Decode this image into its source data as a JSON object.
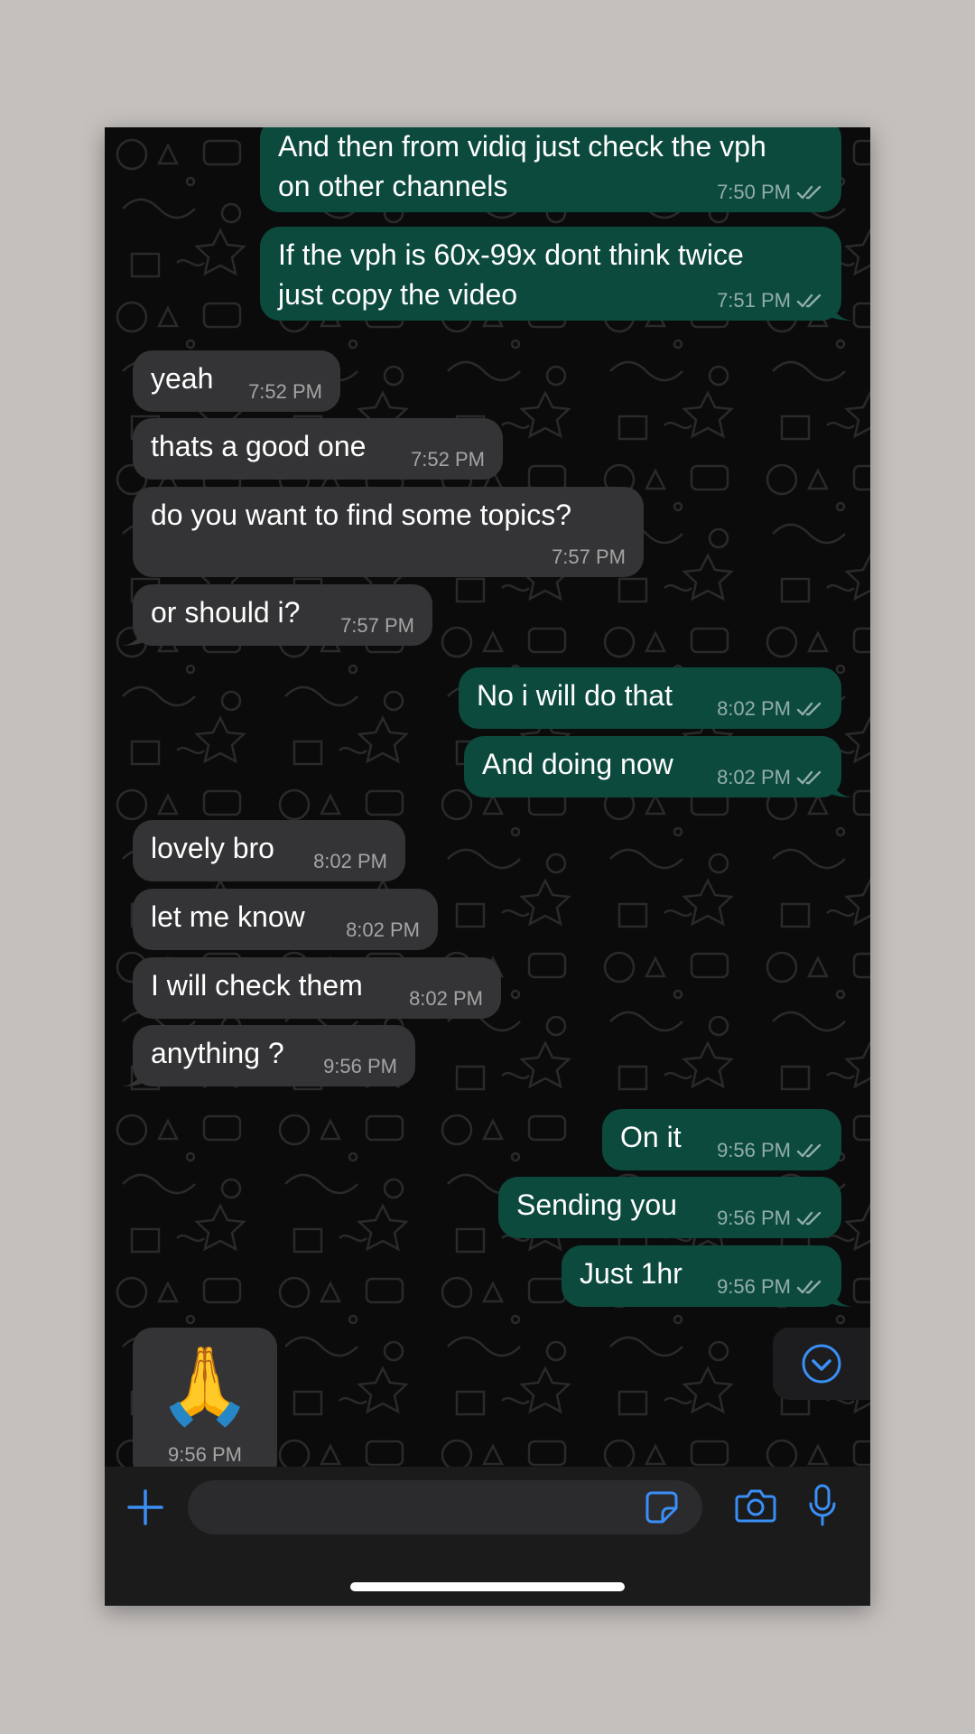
{
  "chat": {
    "messages": [
      {
        "dir": "out",
        "text": "And then from vidiq just check the vph\non other channels",
        "time": "7:50 PM"
      },
      {
        "dir": "out",
        "text": "If the vph is 60x-99x dont think twice\njust copy the video",
        "time": "7:51 PM"
      },
      {
        "dir": "in",
        "text": "yeah",
        "time": "7:52 PM"
      },
      {
        "dir": "in",
        "text": "thats a good one",
        "time": "7:52 PM"
      },
      {
        "dir": "in",
        "text": "do you want to find some topics?",
        "time": "7:57 PM"
      },
      {
        "dir": "in",
        "text": "or should i?",
        "time": "7:57 PM"
      },
      {
        "dir": "out",
        "text": "No i will do that",
        "time": "8:02 PM"
      },
      {
        "dir": "out",
        "text": "And doing now",
        "time": "8:02 PM"
      },
      {
        "dir": "in",
        "text": "lovely bro",
        "time": "8:02 PM"
      },
      {
        "dir": "in",
        "text": "let me know",
        "time": "8:02 PM"
      },
      {
        "dir": "in",
        "text": "I will check them",
        "time": "8:02 PM"
      },
      {
        "dir": "in",
        "text": "anything ?",
        "time": "9:56 PM"
      },
      {
        "dir": "out",
        "text": "On it",
        "time": "9:56 PM"
      },
      {
        "dir": "out",
        "text": "Sending you",
        "time": "9:56 PM"
      },
      {
        "dir": "out",
        "text": "Just 1hr",
        "time": "9:56 PM"
      }
    ],
    "emoji_message": {
      "emoji": "🙏",
      "time": "9:56 PM"
    }
  },
  "icons": {
    "scroll_down": "chevron-down-circle-icon",
    "attach": "plus-icon",
    "sticker": "sticker-icon",
    "camera": "camera-icon",
    "microphone": "microphone-icon",
    "read_receipt": "double-check-icon"
  },
  "colors": {
    "outgoing_bubble": "#0c4a3e",
    "incoming_bubble": "#343436",
    "accent": "#3a8ff7",
    "background": "#0b0b0b"
  }
}
